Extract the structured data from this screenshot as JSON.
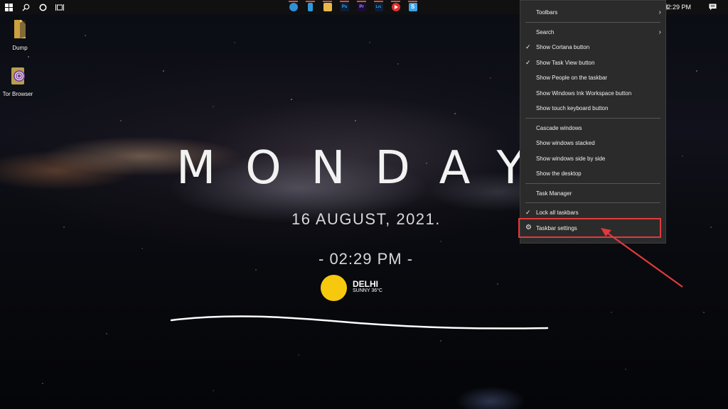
{
  "taskbar": {
    "start_icon": "windows-logo-icon",
    "search_icon": "search-icon",
    "cortana_icon": "cortana-circle-icon",
    "taskview_icon": "task-view-icon",
    "apps": [
      {
        "name": "edge-icon",
        "label": "",
        "color": "#2f8fd8"
      },
      {
        "name": "phone-icon",
        "label": "",
        "color": "#2f9ad8"
      },
      {
        "name": "file-explorer-icon",
        "label": "",
        "color": "#e8b94a"
      },
      {
        "name": "photoshop-icon",
        "label": "Ps",
        "color": "#0b1f3a"
      },
      {
        "name": "premiere-icon",
        "label": "Pr",
        "color": "#1d0b3a"
      },
      {
        "name": "lightroom-classic-icon",
        "label": "Lrc",
        "color": "#0b1f3a"
      },
      {
        "name": "youtube-icon",
        "label": "",
        "color": "#e03030"
      },
      {
        "name": "snipping-tool-icon",
        "label": "",
        "color": "#3aa3e8"
      }
    ],
    "clock": "02:29 PM",
    "notification_icon": "notification-icon",
    "tray_fragment": "))"
  },
  "desktop": {
    "icons": [
      {
        "name": "dump-folder",
        "label": "Dump"
      },
      {
        "name": "tor-browser",
        "label": "Tor Browser"
      }
    ]
  },
  "widget": {
    "day": "MONDAY",
    "date": "16 AUGUST, 2021.",
    "time": "- 02:29 PM -",
    "city": "DELHI",
    "weather": "SUNNY 36°C",
    "sun_color": "#f6c90e"
  },
  "menu": {
    "items": [
      {
        "label": "Toolbars",
        "checked": false,
        "submenu": true
      },
      {
        "separator": true
      },
      {
        "label": "Search",
        "checked": false,
        "submenu": true
      },
      {
        "label": "Show Cortana button",
        "checked": true
      },
      {
        "label": "Show Task View button",
        "checked": true
      },
      {
        "label": "Show People on the taskbar",
        "checked": false
      },
      {
        "label": "Show Windows Ink Workspace button",
        "checked": false
      },
      {
        "label": "Show touch keyboard button",
        "checked": false
      },
      {
        "separator": true
      },
      {
        "label": "Cascade windows",
        "checked": false
      },
      {
        "label": "Show windows stacked",
        "checked": false
      },
      {
        "label": "Show windows side by side",
        "checked": false
      },
      {
        "label": "Show the desktop",
        "checked": false
      },
      {
        "separator": true
      },
      {
        "label": "Task Manager",
        "checked": false
      },
      {
        "separator": true
      },
      {
        "label": "Lock all taskbars",
        "checked": true
      },
      {
        "label": "Taskbar settings",
        "checked": false,
        "icon": "gear-icon"
      }
    ],
    "highlight_color": "#e03a3a"
  }
}
